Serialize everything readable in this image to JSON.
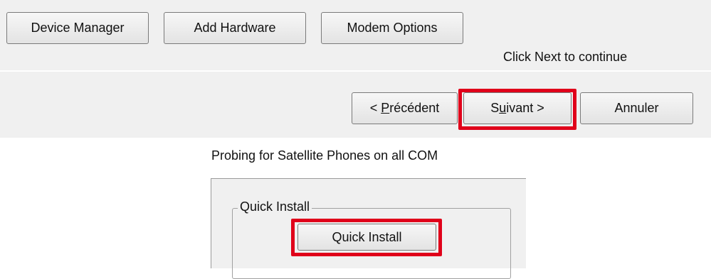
{
  "toolbar": {
    "device_manager_label": "Device Manager",
    "add_hardware_label": "Add Hardware",
    "modem_options_label": "Modem Options"
  },
  "hint": {
    "text": "Click Next to continue"
  },
  "wizard_nav": {
    "previous_label": "< Précédent",
    "previous_prefix": "< ",
    "previous_mnemonic": "P",
    "previous_rest": "récédent",
    "next_label": "Suivant >",
    "next_prefix": "S",
    "next_mnemonic": "u",
    "next_rest": "ivant >",
    "cancel_label": "Annuler"
  },
  "probe": {
    "title": "Probing for Satellite Phones on all COM"
  },
  "quick_install": {
    "group_label": "Quick Install",
    "button_label": "Quick Install"
  },
  "colors": {
    "highlight": "#e0001a",
    "panel": "#f0f0f0"
  }
}
